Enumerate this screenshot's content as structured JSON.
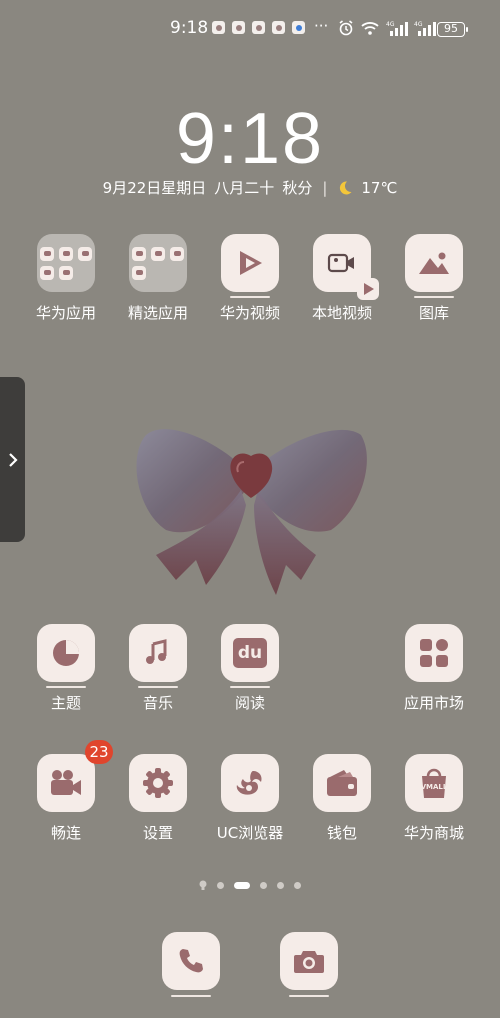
{
  "status_bar": {
    "time": "9:18",
    "more": "···",
    "battery": "95"
  },
  "lock": {
    "clock": "9:18",
    "date": "9月22日星期日",
    "lunar": "八月二十",
    "solar_term": "秋分",
    "divider": "|",
    "temperature": "17℃"
  },
  "row1": [
    {
      "label": "华为应用"
    },
    {
      "label": "精选应用"
    },
    {
      "label": "华为视频"
    },
    {
      "label": "本地视频"
    },
    {
      "label": "图库"
    }
  ],
  "row2": [
    {
      "label": "主题"
    },
    {
      "label": "音乐"
    },
    {
      "label": "阅读"
    },
    {
      "label": "应用市场"
    }
  ],
  "row3": [
    {
      "label": "畅连",
      "badge": "23"
    },
    {
      "label": "设置"
    },
    {
      "label": "UC浏览器"
    },
    {
      "label": "钱包"
    },
    {
      "label": "华为商城"
    }
  ],
  "icon_text": {
    "reader": "du",
    "vmall": "VMALL"
  },
  "colors": {
    "icon_glyph": "#9a6b6d",
    "icon_bg": "#f5ece8",
    "badge": "#e0452d",
    "wallpaper": "#8a8780"
  }
}
